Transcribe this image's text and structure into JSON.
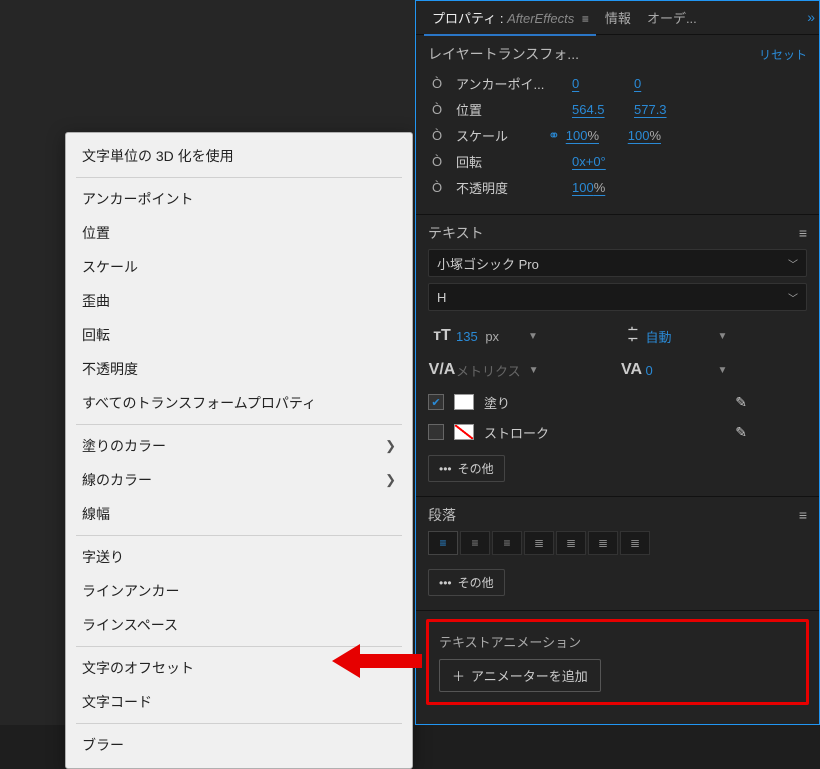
{
  "panel": {
    "tabs": {
      "props": "プロパティ :",
      "app": "AfterEffects",
      "info": "情報",
      "audio": "オーデ..."
    },
    "transform": {
      "title": "レイヤートランスフォ...",
      "reset": "リセット",
      "anchor": {
        "label": "アンカーポイ...",
        "x": "0",
        "y": "0"
      },
      "position": {
        "label": "位置",
        "x": "564.5",
        "y": "577.3"
      },
      "scale": {
        "label": "スケール",
        "x": "100",
        "y": "100",
        "unit": "%"
      },
      "rotation": {
        "label": "回転",
        "v": "0x+0°"
      },
      "opacity": {
        "label": "不透明度",
        "v": "100",
        "unit": "%"
      }
    },
    "text": {
      "title": "テキスト",
      "font": "小塚ゴシック Pro",
      "weight": "H",
      "size": {
        "v": "135",
        "unit": "px"
      },
      "leading": {
        "v": "自動"
      },
      "kerning": {
        "v": "メトリクス"
      },
      "tracking": {
        "v": "0"
      },
      "fill": "塗り",
      "stroke": "ストローク",
      "other": "その他"
    },
    "paragraph": {
      "title": "段落",
      "other": "その他"
    },
    "anim": {
      "title": "テキストアニメーション",
      "add": "アニメーターを追加"
    }
  },
  "menu": {
    "items": [
      {
        "label": "文字単位の 3D 化を使用"
      },
      {
        "sep": true
      },
      {
        "label": "アンカーポイント"
      },
      {
        "label": "位置"
      },
      {
        "label": "スケール"
      },
      {
        "label": "歪曲"
      },
      {
        "label": "回転"
      },
      {
        "label": "不透明度"
      },
      {
        "label": "すべてのトランスフォームプロパティ"
      },
      {
        "sep": true
      },
      {
        "label": "塗りのカラー",
        "sub": true
      },
      {
        "label": "線のカラー",
        "sub": true
      },
      {
        "label": "線幅"
      },
      {
        "sep": true
      },
      {
        "label": "字送り"
      },
      {
        "label": "ラインアンカー"
      },
      {
        "label": "ラインスペース"
      },
      {
        "sep": true
      },
      {
        "label": "文字のオフセット"
      },
      {
        "label": "文字コード"
      },
      {
        "sep": true
      },
      {
        "label": "ブラー"
      }
    ]
  }
}
